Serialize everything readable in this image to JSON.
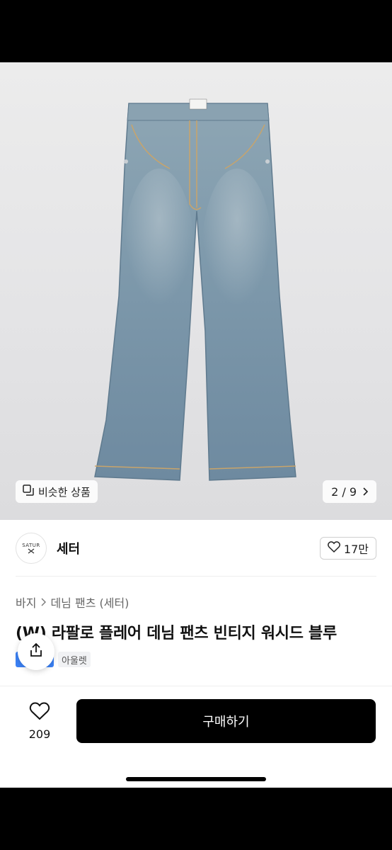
{
  "gallery": {
    "similar_label": "비슷한 상품",
    "counter": "2 / 9",
    "brand_tag": "SATUR"
  },
  "shop": {
    "logo_text": "SATUR",
    "name": "세터",
    "likes": "17만"
  },
  "product": {
    "breadcrumb": [
      "바지",
      "데님 팬츠 (세터)"
    ],
    "title": "(W) 라팔로 플레어 데님 팬츠 빈티지 워시드 블루",
    "badge_outlet": "아울렛"
  },
  "bottom": {
    "wish_count": "209",
    "buy_label": "구매하기"
  },
  "colors": {
    "accent": "#000000",
    "badge_blue": "#3b82f6",
    "denim": "#7c97a8"
  }
}
